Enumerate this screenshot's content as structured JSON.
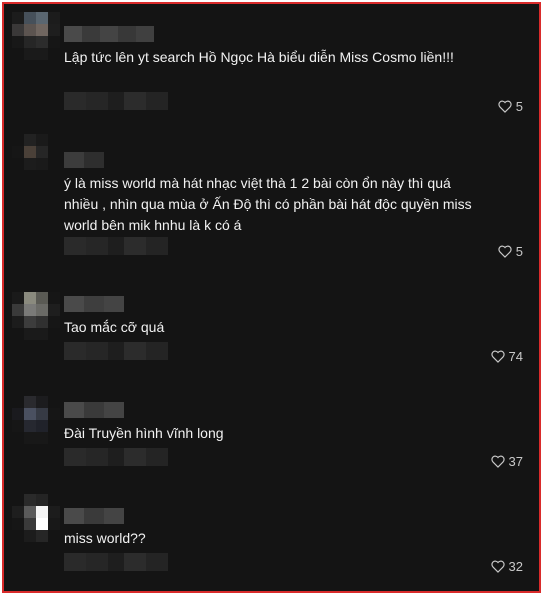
{
  "comments": [
    {
      "text": "Lập tức lên yt search Hồ Ngọc Hà biểu diễn Miss Cosmo liền!!!",
      "likes": "5"
    },
    {
      "text": "ý là miss world mà hát nhạc việt thà 1 2 bài còn ổn này thì quá nhiều , nhìn qua mùa ở Ấn Độ thì có phần bài hát độc quyền miss world bên mik hnhu là k có á",
      "likes": "5"
    },
    {
      "text": "Tao mắc cỡ quá",
      "likes": "74"
    },
    {
      "text": "Đài Truyền hình vĩnh long",
      "likes": "37"
    },
    {
      "text": "miss world??",
      "likes": "32"
    }
  ],
  "icons": {
    "like": "heart-outline-icon"
  },
  "colors": {
    "background": "#141414",
    "frame_border": "#d92b2b",
    "text": "#f2f2f2",
    "muted": "#c8c8c8"
  }
}
